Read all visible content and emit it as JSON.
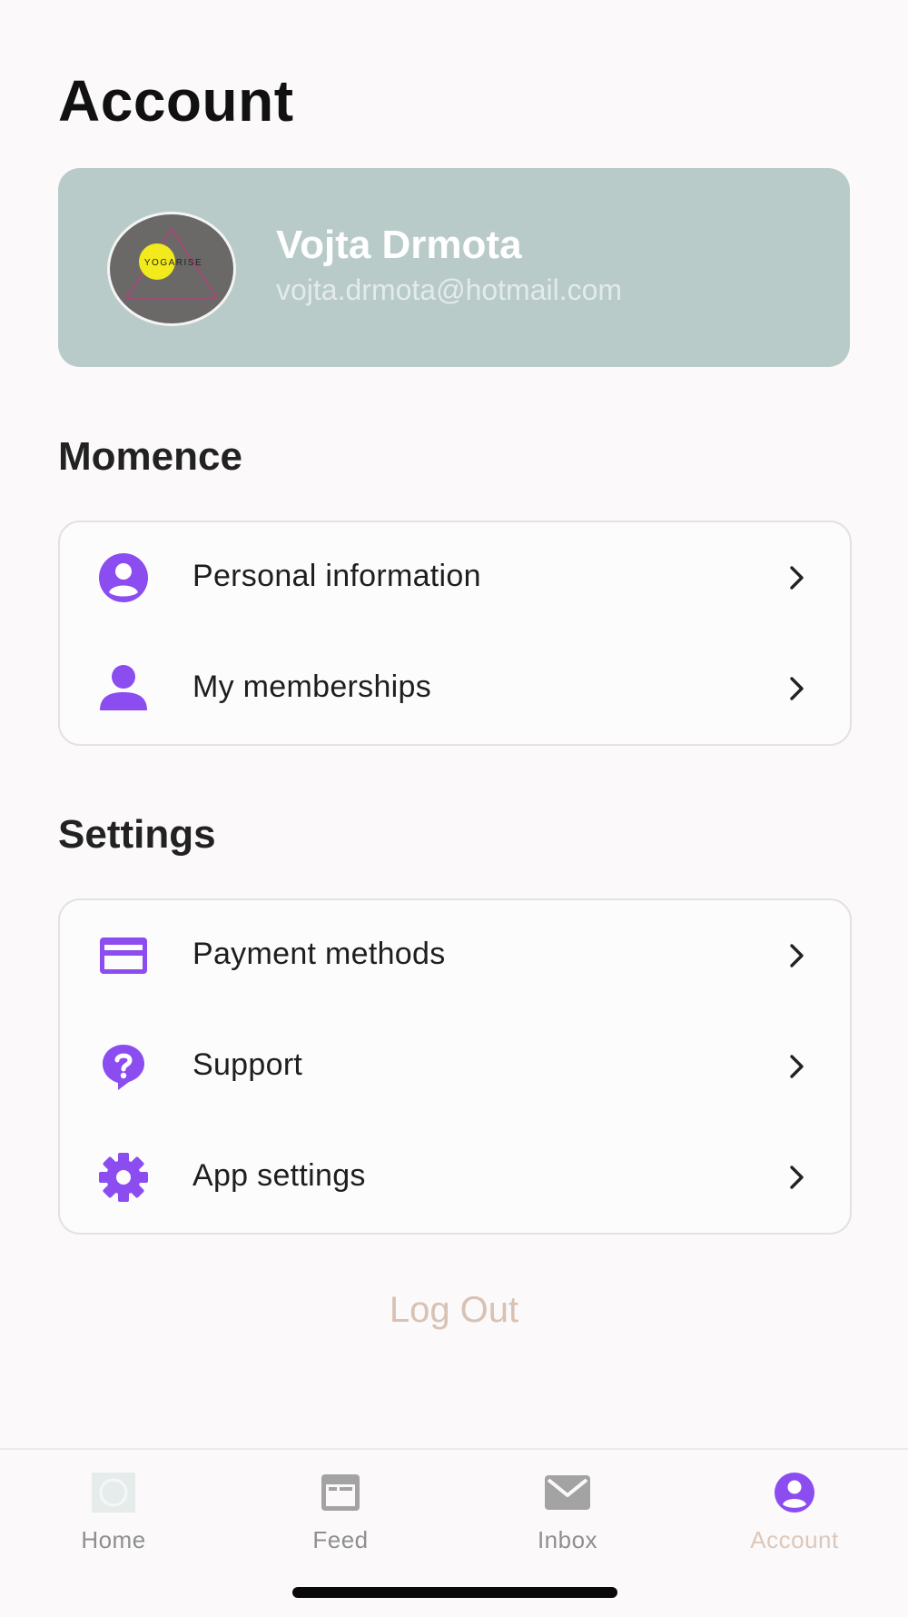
{
  "header": {
    "title": "Account"
  },
  "profile": {
    "name": "Vojta Drmota",
    "email": "vojta.drmota@hotmail.com",
    "avatar_logo_text": "YOGARISE"
  },
  "sections": [
    {
      "heading": "Momence",
      "items": [
        {
          "label": "Personal information",
          "icon": "user-circle-icon"
        },
        {
          "label": "My memberships",
          "icon": "person-icon"
        }
      ]
    },
    {
      "heading": "Settings",
      "items": [
        {
          "label": "Payment methods",
          "icon": "credit-card-icon"
        },
        {
          "label": "Support",
          "icon": "question-bubble-icon"
        },
        {
          "label": "App settings",
          "icon": "gear-icon"
        }
      ]
    }
  ],
  "logout_label": "Log Out",
  "tabbar": {
    "tabs": [
      {
        "label": "Home",
        "icon": "home-icon",
        "active": false
      },
      {
        "label": "Feed",
        "icon": "feed-icon",
        "active": false
      },
      {
        "label": "Inbox",
        "icon": "envelope-icon",
        "active": false
      },
      {
        "label": "Account",
        "icon": "account-icon",
        "active": true
      }
    ]
  },
  "colors": {
    "accent": "#8b4cf0",
    "profile_card": "#b8cbc8",
    "logout": "#d7c2b5",
    "inactive_tab": "#8f8f8f",
    "active_tab_label": "#dcc8bb"
  }
}
